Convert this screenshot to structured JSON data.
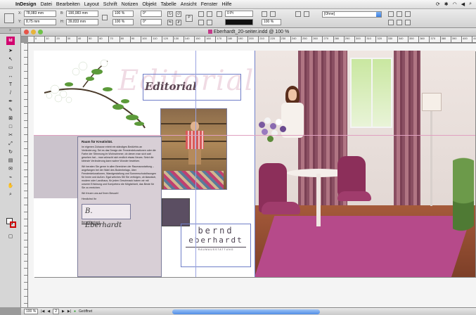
{
  "menubar": {
    "app": "InDesign",
    "items": [
      "Datei",
      "Bearbeiten",
      "Layout",
      "Schrift",
      "Notizen",
      "Objekt",
      "Tabelle",
      "Ansicht",
      "Fenster",
      "Hilfe"
    ]
  },
  "control": {
    "x_label": "X:",
    "x_value": "78,083 mm",
    "y_label": "Y:",
    "y_value": "8,75 mm",
    "b_label": "B:",
    "b_value": "190,083 mm",
    "h_label": "H:",
    "h_value": "39,833 mm",
    "scale_x": "100 %",
    "scale_y": "100 %",
    "angle": "0°",
    "shear": "0°",
    "stroke_weight": "0 Pt",
    "opacity": "100 %",
    "style": "[Ohne]"
  },
  "document": {
    "title": "Eberhardt_20-seiter.indd @ 100 %"
  },
  "tools": {
    "badge": "Id"
  },
  "ruler": {
    "marks": [
      "0",
      "10",
      "20",
      "30",
      "40",
      "50",
      "60",
      "70",
      "80",
      "90",
      "100",
      "110",
      "120",
      "130",
      "140",
      "150",
      "160",
      "170",
      "180",
      "190",
      "200",
      "210",
      "220",
      "230",
      "240",
      "250",
      "260",
      "270",
      "280",
      "290",
      "300",
      "310",
      "320",
      "330",
      "340",
      "350",
      "360",
      "370",
      "380",
      "390",
      "400",
      "410"
    ]
  },
  "page": {
    "headline_bg": "Editorial",
    "headline": "Editorial",
    "text_heading": "Raum für Kreativität.",
    "paragraphs": [
      "Im eigenen Zuhause erlebt ein ständiges Bedürfnis an Veränderung. Sei es das Design der Fensterdekorationen oder die Farbe der Stimmung im Wohnzimmer, ob denen man sich satt gesehen hat – man wünscht sich endlich etwas Neues. Setzt die kleinste Veränderung kann wahre Wunder bewirken.",
      "Wir beraten Sie gerne in allen Bereichen der Raumausstattung – angefangen bei der Wahl des Bodenbelags, über Fensterdekorationen, Wandgestaltung und Sonnenschutzlösungen für Innen und Außen. Egal welches Stil Sie verfolgen, ob klassisch, modern oder Landhaus, für jeden Geschmack haben wir mit unserer Erfahrung und Kompetenz die Möglichkeit, das Beste für Sie zu erreichen.",
      "Wir freuen uns auf Ihren Besuch!"
    ],
    "sign_off": "Herzlichst Ihr",
    "signature": "B. Eberhardt",
    "signer": "Bernd Eberhardt",
    "logo_line1": "bernd",
    "logo_line2": "eberhardt",
    "logo_line3": "RAUMAUSSTATTUNG"
  },
  "status": {
    "zoom": "100 %",
    "page": "2",
    "preflight": "Geöffnet"
  }
}
